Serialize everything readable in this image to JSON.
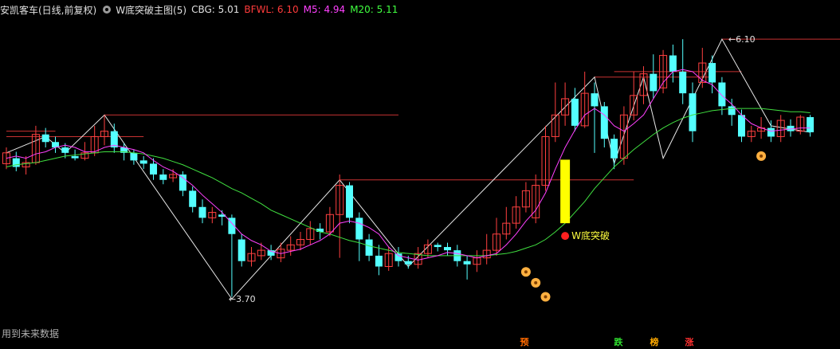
{
  "header": {
    "title": "安凯客车(日线,前复权)",
    "indicator_name": "W底突破主图(5)",
    "cbg": "CBG: 5.01",
    "bfwl": "BFWL: 6.10",
    "m5": "M5: 4.94",
    "m20": "M20: 5.11",
    "colors": {
      "cbg": "#e0e0e0",
      "bfwl": "#ff3b3b",
      "m5": "#ff40ff",
      "m20": "#40ff40"
    }
  },
  "labels": {
    "high": "6.10",
    "low": "3.70",
    "signal": "W底突破",
    "footer": "用到未来数据"
  },
  "badges": [
    {
      "text": "预",
      "color": "#ff6a00"
    },
    {
      "text": "跌",
      "color": "#30e030"
    },
    {
      "text": "榜",
      "color": "#ffaa00"
    },
    {
      "text": "涨",
      "color": "#ff3030"
    }
  ],
  "chart_data": {
    "type": "candlestick",
    "ylim": [
      3.4,
      6.3
    ],
    "candles": [
      [
        4.95,
        5.05,
        5.1,
        4.9
      ],
      [
        5.0,
        4.92,
        5.06,
        4.88
      ],
      [
        4.92,
        4.96,
        5.02,
        4.85
      ],
      [
        4.96,
        5.22,
        5.3,
        4.94
      ],
      [
        5.22,
        5.15,
        5.28,
        5.1
      ],
      [
        5.15,
        5.1,
        5.2,
        5.05
      ],
      [
        5.1,
        5.05,
        5.14,
        5.0
      ],
      [
        5.02,
        5.0,
        5.08,
        4.98
      ],
      [
        5.0,
        5.05,
        5.15,
        4.98
      ],
      [
        5.05,
        5.2,
        5.3,
        5.02
      ],
      [
        5.2,
        5.25,
        5.4,
        5.12
      ],
      [
        5.25,
        5.1,
        5.32,
        5.05
      ],
      [
        5.1,
        5.05,
        5.14,
        4.98
      ],
      [
        5.05,
        4.98,
        5.08,
        4.94
      ],
      [
        4.98,
        4.95,
        5.02,
        4.9
      ],
      [
        4.95,
        4.85,
        5.0,
        4.8
      ],
      [
        4.85,
        4.8,
        4.9,
        4.76
      ],
      [
        4.82,
        4.85,
        4.9,
        4.78
      ],
      [
        4.85,
        4.7,
        4.88,
        4.65
      ],
      [
        4.7,
        4.55,
        4.74,
        4.5
      ],
      [
        4.55,
        4.45,
        4.62,
        4.4
      ],
      [
        4.45,
        4.5,
        4.55,
        4.4
      ],
      [
        4.48,
        4.46,
        4.52,
        4.38
      ],
      [
        4.45,
        4.3,
        4.48,
        3.72
      ],
      [
        4.25,
        4.05,
        4.3,
        4.0
      ],
      [
        4.05,
        4.12,
        4.18,
        4.0
      ],
      [
        4.1,
        4.15,
        4.22,
        4.06
      ],
      [
        4.15,
        4.1,
        4.2,
        4.06
      ],
      [
        4.08,
        4.16,
        4.22,
        4.04
      ],
      [
        4.15,
        4.2,
        4.28,
        4.1
      ],
      [
        4.2,
        4.25,
        4.32,
        4.15
      ],
      [
        4.25,
        4.35,
        4.42,
        4.2
      ],
      [
        4.35,
        4.32,
        4.4,
        4.25
      ],
      [
        4.32,
        4.48,
        4.55,
        4.28
      ],
      [
        4.48,
        4.75,
        4.85,
        4.08
      ],
      [
        4.75,
        4.45,
        4.78,
        4.4
      ],
      [
        4.45,
        4.25,
        4.5,
        4.05
      ],
      [
        4.25,
        4.1,
        4.3,
        4.05
      ],
      [
        4.1,
        4.0,
        4.2,
        3.92
      ],
      [
        4.0,
        4.12,
        4.18,
        3.96
      ],
      [
        4.12,
        4.05,
        4.18,
        4.0
      ],
      [
        4.05,
        4.02,
        4.1,
        3.98
      ],
      [
        4.02,
        4.12,
        4.18,
        3.98
      ],
      [
        4.12,
        4.2,
        4.25,
        4.08
      ],
      [
        4.2,
        4.18,
        4.22,
        4.14
      ],
      [
        4.18,
        4.15,
        4.22,
        4.1
      ],
      [
        4.15,
        4.05,
        4.2,
        4.0
      ],
      [
        4.05,
        4.02,
        4.1,
        3.88
      ],
      [
        4.02,
        4.08,
        4.15,
        3.95
      ],
      [
        4.08,
        4.15,
        4.3,
        4.02
      ],
      [
        4.15,
        4.3,
        4.45,
        4.1
      ],
      [
        4.3,
        4.4,
        4.55,
        4.25
      ],
      [
        4.4,
        4.55,
        4.65,
        4.35
      ],
      [
        4.55,
        4.7,
        4.78,
        4.5
      ],
      [
        4.45,
        4.75,
        4.85,
        4.4
      ],
      [
        4.75,
        5.2,
        5.3,
        4.7
      ],
      [
        5.2,
        5.4,
        5.7,
        5.15
      ],
      [
        5.4,
        5.55,
        5.7,
        5.3
      ],
      [
        5.55,
        5.3,
        5.65,
        5.25
      ],
      [
        5.3,
        5.6,
        5.8,
        5.28
      ],
      [
        5.6,
        5.48,
        5.7,
        5.05
      ],
      [
        5.48,
        5.18,
        5.52,
        5.1
      ],
      [
        5.18,
        5.0,
        5.22,
        4.9
      ],
      [
        5.0,
        5.4,
        5.48,
        4.94
      ],
      [
        5.4,
        5.58,
        5.8,
        5.35
      ],
      [
        5.58,
        5.78,
        5.85,
        5.5
      ],
      [
        5.78,
        5.62,
        5.96,
        5.55
      ],
      [
        5.65,
        5.95,
        6.0,
        5.6
      ],
      [
        5.95,
        5.8,
        6.05,
        5.7
      ],
      [
        5.8,
        5.6,
        6.1,
        5.5
      ],
      [
        5.6,
        5.25,
        5.7,
        5.15
      ],
      [
        5.7,
        5.88,
        6.02,
        5.65
      ],
      [
        5.88,
        5.7,
        5.95,
        5.6
      ],
      [
        5.7,
        5.48,
        5.75,
        5.4
      ],
      [
        5.48,
        5.4,
        5.55,
        5.3
      ],
      [
        5.4,
        5.2,
        5.45,
        5.15
      ],
      [
        5.2,
        5.25,
        5.3,
        5.15
      ],
      [
        5.25,
        5.28,
        5.38,
        5.18
      ],
      [
        5.28,
        5.2,
        5.35,
        5.15
      ],
      [
        5.2,
        5.35,
        5.4,
        5.15
      ],
      [
        5.3,
        5.25,
        5.36,
        5.2
      ],
      [
        5.25,
        5.38,
        5.4,
        5.22
      ],
      [
        5.38,
        5.24,
        5.4,
        5.2
      ]
    ],
    "m5": [
      5.0,
      5.02,
      5.0,
      5.04,
      5.06,
      5.1,
      5.12,
      5.1,
      5.06,
      5.06,
      5.1,
      5.12,
      5.1,
      5.08,
      5.05,
      4.98,
      4.92,
      4.88,
      4.82,
      4.75,
      4.66,
      4.58,
      4.5,
      4.4,
      4.3,
      4.24,
      4.2,
      4.14,
      4.12,
      4.14,
      4.16,
      4.2,
      4.24,
      4.3,
      4.4,
      4.42,
      4.4,
      4.36,
      4.3,
      4.18,
      4.1,
      4.08,
      4.06,
      4.08,
      4.1,
      4.13,
      4.12,
      4.1,
      4.08,
      4.1,
      4.12,
      4.2,
      4.3,
      4.42,
      4.52,
      4.68,
      4.9,
      5.1,
      5.26,
      5.4,
      5.46,
      5.4,
      5.3,
      5.25,
      5.32,
      5.4,
      5.55,
      5.7,
      5.8,
      5.82,
      5.8,
      5.72,
      5.68,
      5.58,
      5.5,
      5.4,
      5.32,
      5.28,
      5.25,
      5.26,
      5.27,
      5.28,
      5.28
    ],
    "m20": [
      4.92,
      4.94,
      4.95,
      4.96,
      4.98,
      5.0,
      5.02,
      5.03,
      5.04,
      5.05,
      5.06,
      5.06,
      5.06,
      5.05,
      5.04,
      5.02,
      5.0,
      4.97,
      4.94,
      4.9,
      4.86,
      4.82,
      4.77,
      4.72,
      4.68,
      4.63,
      4.58,
      4.52,
      4.48,
      4.44,
      4.4,
      4.36,
      4.32,
      4.3,
      4.27,
      4.24,
      4.22,
      4.19,
      4.17,
      4.15,
      4.13,
      4.12,
      4.11,
      4.1,
      4.1,
      4.1,
      4.1,
      4.1,
      4.1,
      4.1,
      4.11,
      4.12,
      4.14,
      4.17,
      4.2,
      4.25,
      4.32,
      4.4,
      4.5,
      4.6,
      4.72,
      4.82,
      4.92,
      5.0,
      5.08,
      5.15,
      5.22,
      5.28,
      5.33,
      5.37,
      5.4,
      5.42,
      5.44,
      5.45,
      5.46,
      5.46,
      5.46,
      5.46,
      5.45,
      5.44,
      5.43,
      5.43,
      5.42
    ],
    "zigzag": [
      [
        0,
        5.05
      ],
      [
        4,
        5.2
      ],
      [
        6,
        5.05
      ],
      [
        10,
        5.4
      ],
      [
        23,
        3.7
      ],
      [
        34,
        4.8
      ],
      [
        41,
        4.0
      ],
      [
        60,
        5.75
      ],
      [
        62,
        4.95
      ],
      [
        65,
        5.75
      ],
      [
        67,
        5.0
      ],
      [
        73,
        6.1
      ],
      [
        78,
        5.3
      ],
      [
        82,
        5.24
      ]
    ],
    "resistance_lines": [
      {
        "y": 5.2,
        "from": 0,
        "to": 14
      },
      {
        "y": 5.25,
        "from": 0,
        "to": 5
      },
      {
        "y": 5.4,
        "from": 10,
        "to": 40
      },
      {
        "y": 4.8,
        "from": 34,
        "to": 64
      },
      {
        "y": 5.75,
        "from": 60,
        "to": 72
      },
      {
        "y": 5.8,
        "from": 62,
        "to": 75
      },
      {
        "y": 6.1,
        "from": 73,
        "to": 87
      }
    ],
    "signal": {
      "index": 57,
      "bar_low": 4.4,
      "bar_high": 4.95
    },
    "flower_markers": [
      [
        53,
        3.95
      ],
      [
        54,
        3.85
      ],
      [
        55,
        3.72
      ],
      [
        77,
        5.02
      ]
    ]
  }
}
